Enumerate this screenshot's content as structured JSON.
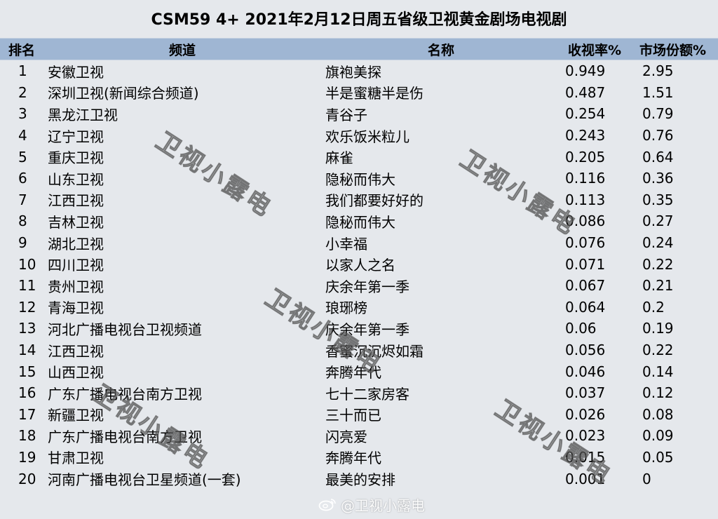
{
  "title": "CSM59 4+ 2021年2月12日周五省级卫视黄金剧场电视剧",
  "columns": {
    "rank": "排名",
    "channel": "频道",
    "name": "名称",
    "rating": "收视率%",
    "share": "市场份额%"
  },
  "rows": [
    {
      "rank": "1",
      "channel": "安徽卫视",
      "name": "旗袍美探",
      "rating": "0.949",
      "share": "2.95"
    },
    {
      "rank": "2",
      "channel": "深圳卫视(新闻综合频道)",
      "name": "半是蜜糖半是伤",
      "rating": "0.487",
      "share": "1.51"
    },
    {
      "rank": "3",
      "channel": "黑龙江卫视",
      "name": "青谷子",
      "rating": "0.254",
      "share": "0.79"
    },
    {
      "rank": "4",
      "channel": "辽宁卫视",
      "name": "欢乐饭米粒儿",
      "rating": "0.243",
      "share": "0.76"
    },
    {
      "rank": "5",
      "channel": "重庆卫视",
      "name": "麻雀",
      "rating": "0.205",
      "share": "0.64"
    },
    {
      "rank": "6",
      "channel": "山东卫视",
      "name": "隐秘而伟大",
      "rating": "0.116",
      "share": "0.36"
    },
    {
      "rank": "7",
      "channel": "江西卫视",
      "name": "我们都要好好的",
      "rating": "0.113",
      "share": "0.35"
    },
    {
      "rank": "8",
      "channel": "吉林卫视",
      "name": "隐秘而伟大",
      "rating": "0.086",
      "share": "0.27"
    },
    {
      "rank": "9",
      "channel": "湖北卫视",
      "name": "小幸福",
      "rating": "0.076",
      "share": "0.24"
    },
    {
      "rank": "10",
      "channel": "四川卫视",
      "name": "以家人之名",
      "rating": "0.071",
      "share": "0.22"
    },
    {
      "rank": "11",
      "channel": "贵州卫视",
      "name": "庆余年第一季",
      "rating": "0.067",
      "share": "0.21"
    },
    {
      "rank": "12",
      "channel": "青海卫视",
      "name": "琅琊榜",
      "rating": "0.064",
      "share": "0.2"
    },
    {
      "rank": "13",
      "channel": "河北广播电视台卫视频道",
      "name": "庆余年第一季",
      "rating": "0.06",
      "share": "0.19"
    },
    {
      "rank": "14",
      "channel": "江西卫视",
      "name": "香蜜沉沉烬如霜",
      "rating": "0.056",
      "share": "0.22"
    },
    {
      "rank": "15",
      "channel": "山西卫视",
      "name": "奔腾年代",
      "rating": "0.046",
      "share": "0.14"
    },
    {
      "rank": "16",
      "channel": "广东广播电视台南方卫视",
      "name": "七十二家房客",
      "rating": "0.037",
      "share": "0.12"
    },
    {
      "rank": "17",
      "channel": "新疆卫视",
      "name": "三十而已",
      "rating": "0.026",
      "share": "0.08"
    },
    {
      "rank": "18",
      "channel": "广东广播电视台南方卫视",
      "name": "闪亮爱",
      "rating": "0.023",
      "share": "0.09"
    },
    {
      "rank": "19",
      "channel": "甘肃卫视",
      "name": "奔腾年代",
      "rating": "0.015",
      "share": "0.05"
    },
    {
      "rank": "20",
      "channel": "河南广播电视台卫星频道(一套)",
      "name": "最美的安排",
      "rating": "0.001",
      "share": "0"
    }
  ],
  "watermark": {
    "text": "卫视小露电",
    "weibo_handle": "@卫视小露电",
    "icon": "weibo-icon"
  },
  "colors": {
    "background": "#e5e8ec",
    "header": "#9fb6d3"
  }
}
